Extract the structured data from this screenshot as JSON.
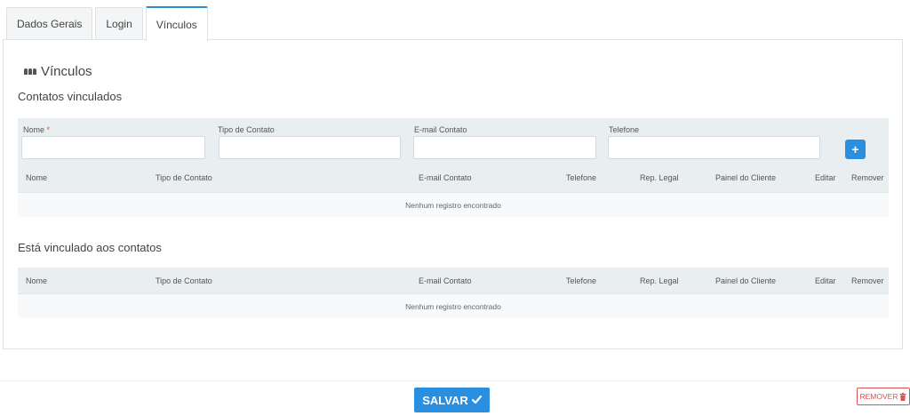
{
  "tabs": [
    {
      "label": "Dados Gerais"
    },
    {
      "label": "Login"
    },
    {
      "label": "Vínculos"
    }
  ],
  "section_title": "Vínculos",
  "linked_contacts": {
    "title": "Contatos vinculados",
    "form": {
      "name_label": "Nome",
      "name_required_mark": "*",
      "type_label": "Tipo de Contato",
      "email_label": "E-mail Contato",
      "phone_label": "Telefone",
      "name_value": "",
      "type_value": "",
      "email_value": "",
      "phone_value": "",
      "add_label": "+"
    },
    "columns": [
      "Nome",
      "Tipo de Contato",
      "E-mail Contato",
      "Telefone",
      "Rep. Legal",
      "Painel do Cliente",
      "Editar",
      "Remover"
    ],
    "empty_message": "Nenhum registro encontrado"
  },
  "linked_to": {
    "title": "Está vinculado aos contatos",
    "columns": [
      "Nome",
      "Tipo de Contato",
      "E-mail Contato",
      "Telefone",
      "Rep. Legal",
      "Painel do Cliente",
      "Editar",
      "Remover"
    ],
    "empty_message": "Nenhum registro encontrado"
  },
  "footer": {
    "save_label": "SALVAR",
    "save_icon": "checkmark-icon",
    "remove_label": "REMOVER",
    "remove_icon": "trash-icon"
  }
}
